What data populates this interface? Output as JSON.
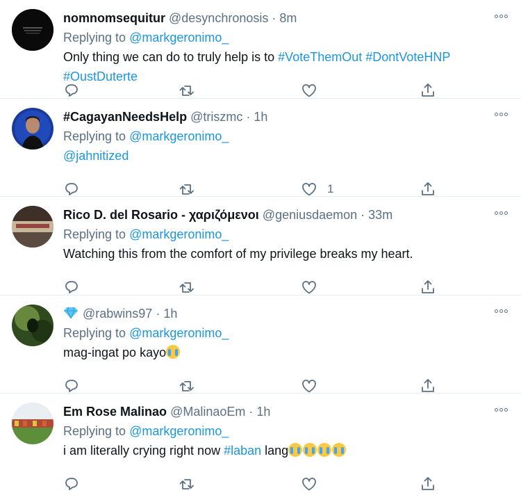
{
  "tweets": [
    {
      "name": "nomnomsequitur",
      "handle": "@desynchronosis",
      "time": "8m",
      "replying_prefix": "Replying to ",
      "replying_to": "@markgeronimo_",
      "text_plain": "Only thing we can do to truly help is to ",
      "hashtag1": "#VoteThemOut",
      "hashtag2": "#DontVoteHNP",
      "hashtag3": "#OustDuterte",
      "like_count": ""
    },
    {
      "name": "#CagayanNeedsHelp",
      "handle": "@triszmc",
      "time": "1h",
      "replying_prefix": "Replying to ",
      "replying_to": "@markgeronimo_",
      "mention": "@jahnitized",
      "like_count": "1"
    },
    {
      "name": "Rico D. del Rosario - χαριζόμενοι",
      "handle": "@geniusdaemon",
      "time": "33m",
      "replying_prefix": "Replying to ",
      "replying_to": "@markgeronimo_",
      "text": "Watching this from the comfort of my privilege breaks my heart.",
      "like_count": ""
    },
    {
      "name_icon": "blue-diamond-icon",
      "handle": "@rabwins97",
      "time": "1h",
      "replying_prefix": "Replying to ",
      "replying_to": "@markgeronimo_",
      "text": "mag-ingat po kayo",
      "emoji_icon": "loudly-crying-face-icon",
      "like_count": ""
    },
    {
      "name": "Em Rose Malinao",
      "handle": "@MalinaoEm",
      "time": "1h",
      "replying_prefix": "Replying to ",
      "replying_to": "@markgeronimo_",
      "text_plain": "i am literally crying right now ",
      "hashtag": "#laban",
      "text_after": " lang",
      "emoji_icon": "loudly-crying-face-icon",
      "like_count": ""
    }
  ],
  "separator": " · ",
  "colors": {
    "link": "#1b95e0",
    "secondary": "#5b7083",
    "primary_text": "#0f1419",
    "divider": "#e6ecf0"
  },
  "icons": {
    "reply": "reply-icon",
    "retweet": "retweet-icon",
    "like": "heart-icon",
    "share": "share-icon",
    "more": "more-icon"
  }
}
